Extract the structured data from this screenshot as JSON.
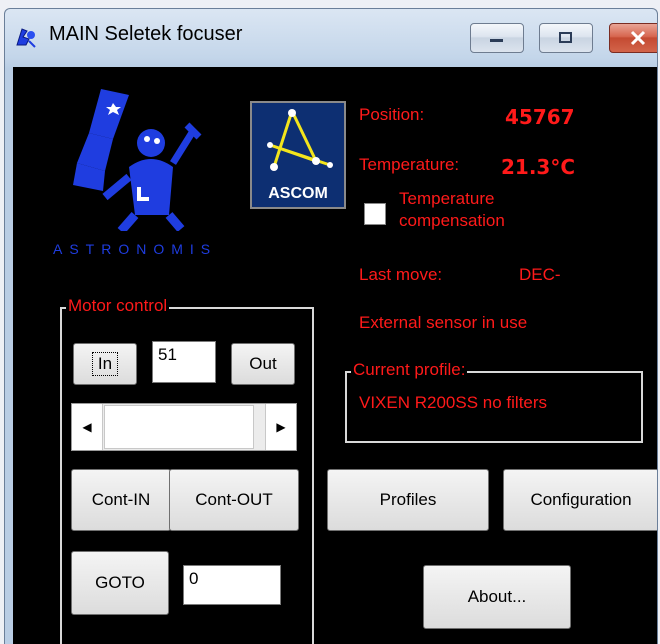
{
  "window": {
    "title": "MAIN Seletek focuser"
  },
  "logo": {
    "text": "ASTRONOMIS"
  },
  "ascom": {
    "label": "ASCOM"
  },
  "status": {
    "position_label": "Position:",
    "position_value": "45767",
    "temperature_label": "Temperature:",
    "temperature_value": "21.3°C",
    "temp_comp_label_line1": "Temperature",
    "temp_comp_label_line2": "compensation",
    "last_move_label": "Last move:",
    "last_move_value": "DEC-",
    "sensor_text": "External sensor in use"
  },
  "motor": {
    "group_label": "Motor control",
    "in_label": "In",
    "step_value": "51",
    "out_label": "Out",
    "cont_in_label": "Cont-IN",
    "cont_out_label": "Cont-OUT",
    "goto_label": "GOTO",
    "goto_value": "0"
  },
  "profile": {
    "group_label": "Current profile:",
    "value": "VIXEN R200SS no filters"
  },
  "buttons": {
    "profiles": "Profiles",
    "configuration": "Configuration",
    "about": "About..."
  },
  "colors": {
    "status_text": "#ff1a1a",
    "client_bg": "#000000",
    "logo_blue": "#1f3de0"
  }
}
